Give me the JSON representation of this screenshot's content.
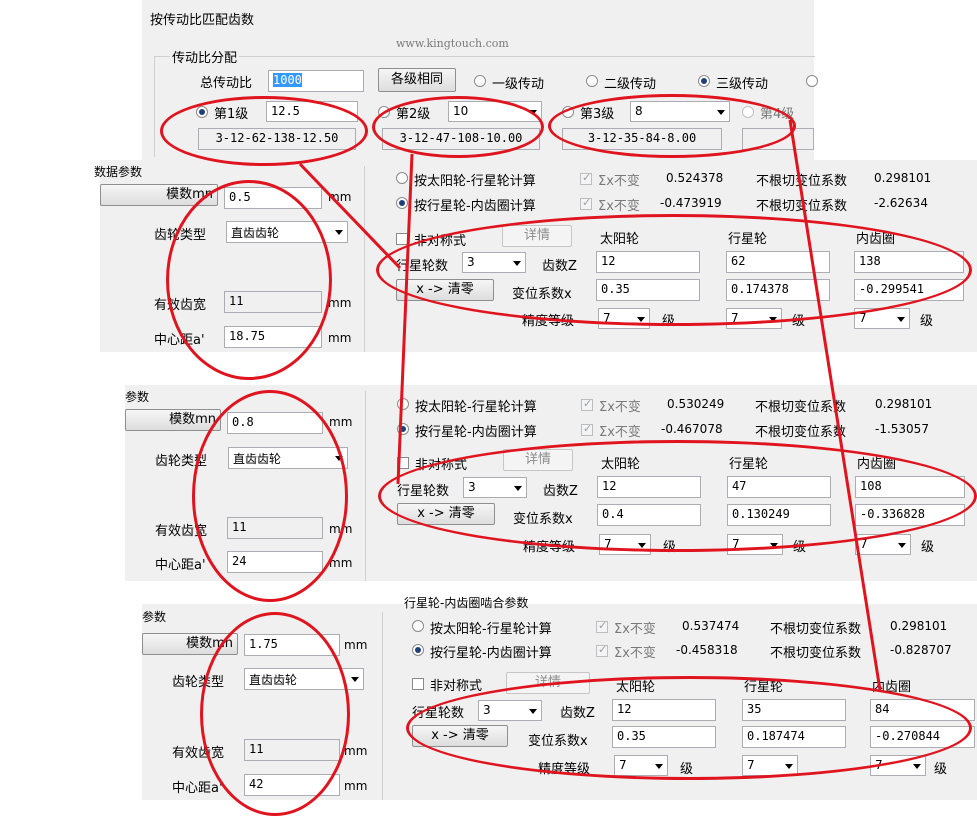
{
  "top": {
    "title": "按传动比匹配齿数",
    "watermark": "www.kingtouch.com",
    "group_title": "传动比分配",
    "total_ratio_label": "总传动比",
    "total_ratio_value": "1000",
    "same_button": "各级相同",
    "radio_one": "一级传动",
    "radio_two": "二级传动",
    "radio_three": "三级传动",
    "stage1_label": "第1级",
    "stage1_value": "12.5",
    "stage1_result": "3-12-62-138-12.50",
    "stage2_label": "第2级",
    "stage2_value": "10",
    "stage2_result": "3-12-47-108-10.00",
    "stage3_label": "第3级",
    "stage3_value": "8",
    "stage3_result": "3-12-35-84-8.00",
    "stage4_label": "第4级"
  },
  "panels": [
    {
      "header": "数据参数",
      "module_label": "模数mn",
      "module_value": "0.5",
      "unit_mm": "mm",
      "gear_type_label": "齿轮类型",
      "gear_type_value": "直齿齿轮",
      "face_width_label": "有效齿宽",
      "face_width_value": "11",
      "center_label": "中心距a'",
      "center_value": "18.75",
      "calc_sun_label": "按太阳轮-行星轮计算",
      "calc_ring_label": "按行星轮-内齿圈计算",
      "sigma_label": "Σx不变",
      "sigma1_value": "0.524378",
      "sigma2_value": "-0.473919",
      "nocut_label": "不根切变位系数",
      "nocut1_value": "0.298101",
      "nocut2_value": "-2.62634",
      "asym_label": "非对称式",
      "detail_button": "详情",
      "sun_label": "太阳轮",
      "planet_label": "行星轮",
      "ring_label": "内齿圈",
      "planet_count_label": "行星轮数",
      "planet_count_value": "3",
      "teeth_label": "齿数Z",
      "z_sun": "12",
      "z_planet": "62",
      "z_ring": "138",
      "clear_button": "x -> 清零",
      "shift_label": "变位系数x",
      "x_sun": "0.35",
      "x_planet": "0.174378",
      "x_ring": "-0.299541",
      "precision_label": "精度等级",
      "precision_value": "7",
      "grade_label": "级"
    },
    {
      "header": "参数",
      "module_label": "模数mn",
      "module_value": "0.8",
      "unit_mm": "mm",
      "gear_type_label": "齿轮类型",
      "gear_type_value": "直齿齿轮",
      "face_width_label": "有效齿宽",
      "face_width_value": "11",
      "center_label": "中心距a'",
      "center_value": "24",
      "calc_sun_label": "按太阳轮-行星轮计算",
      "calc_ring_label": "按行星轮-内齿圈计算",
      "sigma_label": "Σx不变",
      "sigma1_value": "0.530249",
      "sigma2_value": "-0.467078",
      "nocut_label": "不根切变位系数",
      "nocut1_value": "0.298101",
      "nocut2_value": "-1.53057",
      "asym_label": "非对称式",
      "detail_button": "详情",
      "sun_label": "太阳轮",
      "planet_label": "行星轮",
      "ring_label": "内齿圈",
      "planet_count_label": "行星轮数",
      "planet_count_value": "3",
      "teeth_label": "齿数Z",
      "z_sun": "12",
      "z_planet": "47",
      "z_ring": "108",
      "clear_button": "x -> 清零",
      "shift_label": "变位系数x",
      "x_sun": "0.4",
      "x_planet": "0.130249",
      "x_ring": "-0.336828",
      "precision_label": "精度等级",
      "precision_value": "7",
      "grade_label": "级"
    },
    {
      "header": "参数",
      "section_title": "行星轮-内齿圈啮合参数",
      "module_label": "模数mn",
      "module_value": "1.75",
      "unit_mm": "mm",
      "gear_type_label": "齿轮类型",
      "gear_type_value": "直齿齿轮",
      "face_width_label": "有效齿宽",
      "face_width_value": "11",
      "center_label": "中心距a'",
      "center_value": "42",
      "calc_sun_label": "按太阳轮-行星轮计算",
      "calc_ring_label": "按行星轮-内齿圈计算",
      "sigma_label": "Σx不变",
      "sigma1_value": "0.537474",
      "sigma2_value": "-0.458318",
      "nocut_label": "不根切变位系数",
      "nocut1_value": "0.298101",
      "nocut2_value": "-0.828707",
      "asym_label": "非对称式",
      "detail_button": "详情",
      "sun_label": "太阳轮",
      "planet_label": "行星轮",
      "ring_label": "内齿圈",
      "planet_count_label": "行星轮数",
      "planet_count_value": "3",
      "teeth_label": "齿数Z",
      "z_sun": "12",
      "z_planet": "35",
      "z_ring": "84",
      "clear_button": "x -> 清零",
      "shift_label": "变位系数x",
      "x_sun": "0.35",
      "x_planet": "0.187474",
      "x_ring": "-0.270844",
      "precision_label": "精度等级",
      "precision_value": "7",
      "grade_label": "级"
    }
  ],
  "colors": {
    "annotation": "#e0141e",
    "window_bg": "#f0f0f0",
    "selection": "#3399ff"
  }
}
